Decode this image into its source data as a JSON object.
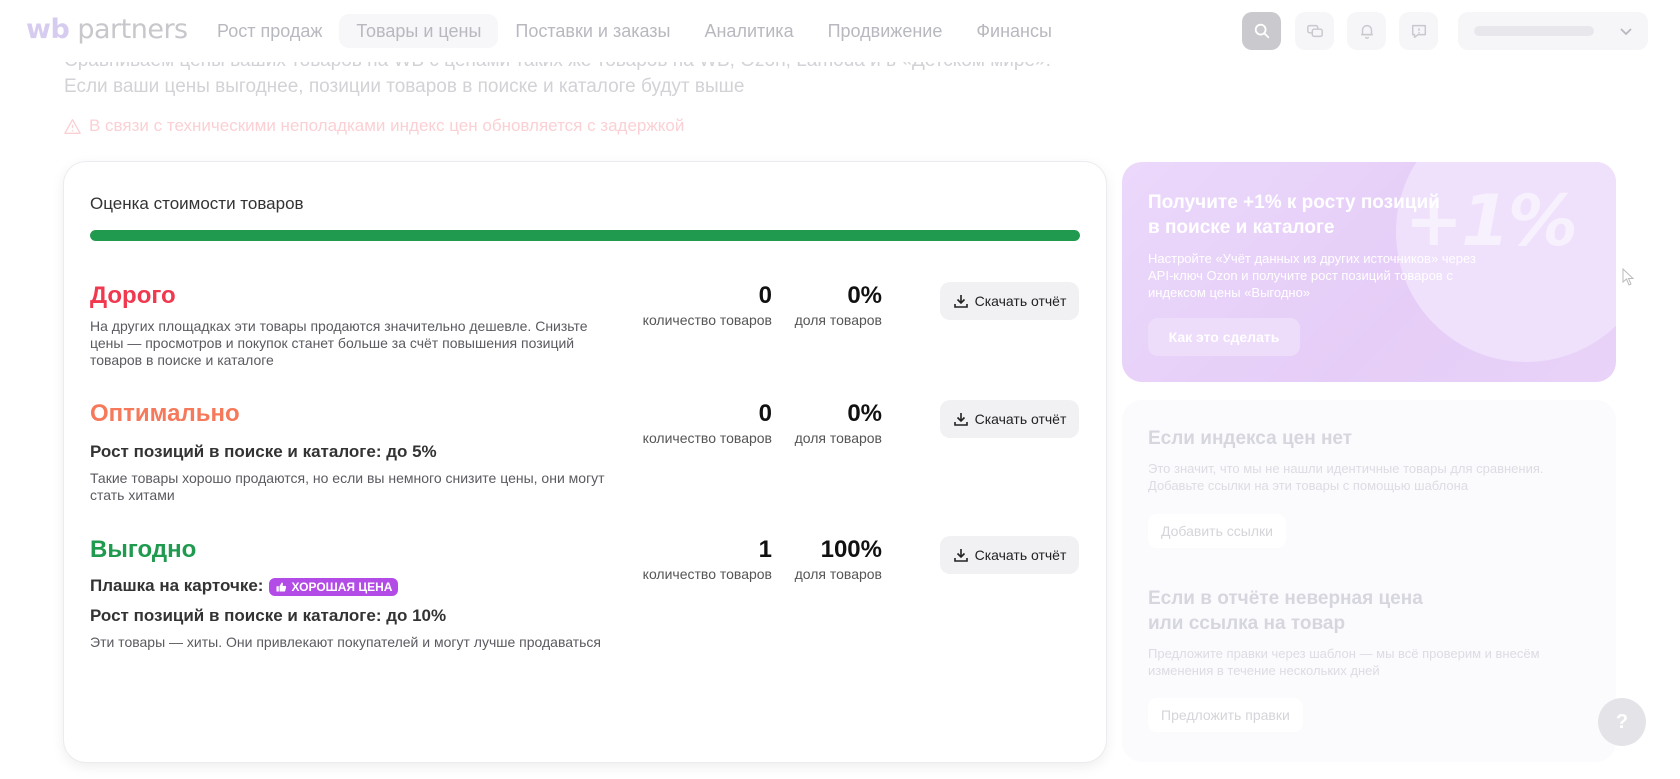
{
  "header": {
    "logo_wb": "wb",
    "logo_text": " partners",
    "nav": [
      {
        "label": "Рост продаж"
      },
      {
        "label": "Товары и цены"
      },
      {
        "label": "Поставки и заказы"
      },
      {
        "label": "Аналитика"
      },
      {
        "label": "Продвижение"
      },
      {
        "label": "Финансы"
      }
    ],
    "active_nav": "Товары и цены"
  },
  "intro": {
    "line1": "Сравниваем цены ваших товаров на WB с ценами таких же товаров на WB, Ozon, Lamoda и в «Детском мире».",
    "line2": "Если ваши цены выгоднее, позиции товаров в поиске и каталоге будут выше"
  },
  "warning": "В связи с техническими неполадками индекс цен обновляется с задержкой",
  "card": {
    "title": "Оценка стоимости товаров",
    "progress_fraction": 1.0,
    "progress_color": "#1f9a4e",
    "download_label": "Скачать отчёт",
    "count_caption": "количество товаров",
    "share_caption": "доля товаров",
    "sections": {
      "expensive": {
        "title": "Дорого",
        "color": "#f0384f",
        "desc": "На других площадках эти товары продаются значительно дешевле. Снизьте цены — просмотров и покупок станет больше за счёт повышения позиций товаров в поиске и каталоге",
        "count": "0",
        "share": "0%"
      },
      "optimal": {
        "title": "Оптимально",
        "color": "#f5795a",
        "growth": "Рост позиций в поиске и каталоге: до 5%",
        "desc": "Такие товары хорошо продаются, но если вы немного снизите цены, они могут стать хитами",
        "count": "0",
        "share": "0%"
      },
      "good": {
        "title": "Выгодно",
        "color": "#1f9a4e",
        "badge_label": "Плашка на карточке:",
        "badge_text": "ХОРОШАЯ ЦЕНА",
        "growth": "Рост позиций в поиске и каталоге: до 10%",
        "desc": "Эти товары — хиты. Они привлекают покупателей и могут лучше продаваться",
        "count": "1",
        "share": "100%"
      }
    }
  },
  "promo": {
    "big": "+1%",
    "title": "Получите +1% к росту позиций в поиске и каталоге",
    "text": "Настройте «Учёт данных из других источников» через API-ключ Ozon и получите рост позиций товаров с индексом цены «Выгодно»",
    "button": "Как это сделать"
  },
  "info": {
    "block1_title": "Если индекса цен нет",
    "block1_text": "Это значит, что мы не нашли идентичные товары для сравнения. Добавьте ссылки на эти товары с помощью шаблона",
    "block1_button": "Добавить ссылки",
    "block2_title": "Если в отчёте неверная цена или ссылка на товар",
    "block2_text": "Предложите правки через шаблон — мы всё проверим и внесём изменения в течение нескольких дней",
    "block2_button": "Предложить правки"
  },
  "help": "?"
}
